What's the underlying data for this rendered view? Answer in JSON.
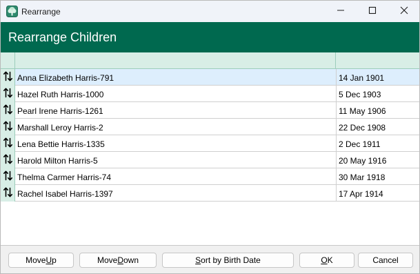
{
  "window": {
    "title": "Rearrange",
    "app_icon": "tree-icon",
    "controls": [
      "minimize-icon",
      "maximize-icon",
      "close-icon"
    ]
  },
  "header": {
    "title": "Rearrange Children",
    "color": "#00694f"
  },
  "grid": {
    "columns": [
      "",
      "",
      ""
    ],
    "rows": [
      {
        "name": "Anna Elizabeth Harris-791",
        "date": "14 Jan 1901",
        "selected": true
      },
      {
        "name": "Hazel Ruth Harris-1000",
        "date": "5 Dec 1903"
      },
      {
        "name": "Pearl Irene Harris-1261",
        "date": "11 May 1906"
      },
      {
        "name": "Marshall Leroy Harris-2",
        "date": "22 Dec 1908"
      },
      {
        "name": "Lena Bettie Harris-1335",
        "date": "2 Dec 1911"
      },
      {
        "name": "Harold Milton Harris-5",
        "date": "20 May 1916"
      },
      {
        "name": "Thelma Carmer Harris-74",
        "date": "30 Mar 1918"
      },
      {
        "name": "Rachel Isabel Harris-1397",
        "date": "17 Apr 1914"
      }
    ]
  },
  "buttons": {
    "move_up": {
      "pre": "Move ",
      "key": "U",
      "post": "p"
    },
    "move_down": {
      "pre": "Move ",
      "key": "D",
      "post": "own"
    },
    "sort": {
      "pre": "",
      "key": "S",
      "post": "ort by Birth Date"
    },
    "ok": {
      "pre": "",
      "key": "O",
      "post": "K"
    },
    "cancel": {
      "pre": "Cancel",
      "key": "",
      "post": ""
    }
  }
}
